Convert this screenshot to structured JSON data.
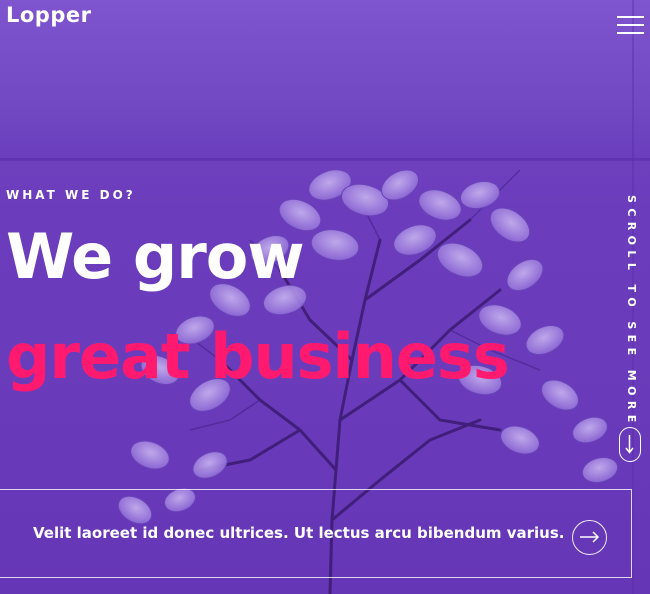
{
  "header": {
    "logo": "Lopper",
    "menu_icon": "hamburger-icon"
  },
  "hero": {
    "eyebrow": "WHAT WE DO?",
    "headline_line1": "We grow",
    "headline_line2": "great business",
    "accent_color": "#ff1a70",
    "scroll_label": "SCROLL TO SEE MORE",
    "scroll_icon": "arrow-down-icon"
  },
  "promo": {
    "text": "Velit laoreet id donec ultrices. Ut lectus arcu bibendum varius.",
    "arrow_icon": "arrow-right-icon"
  }
}
